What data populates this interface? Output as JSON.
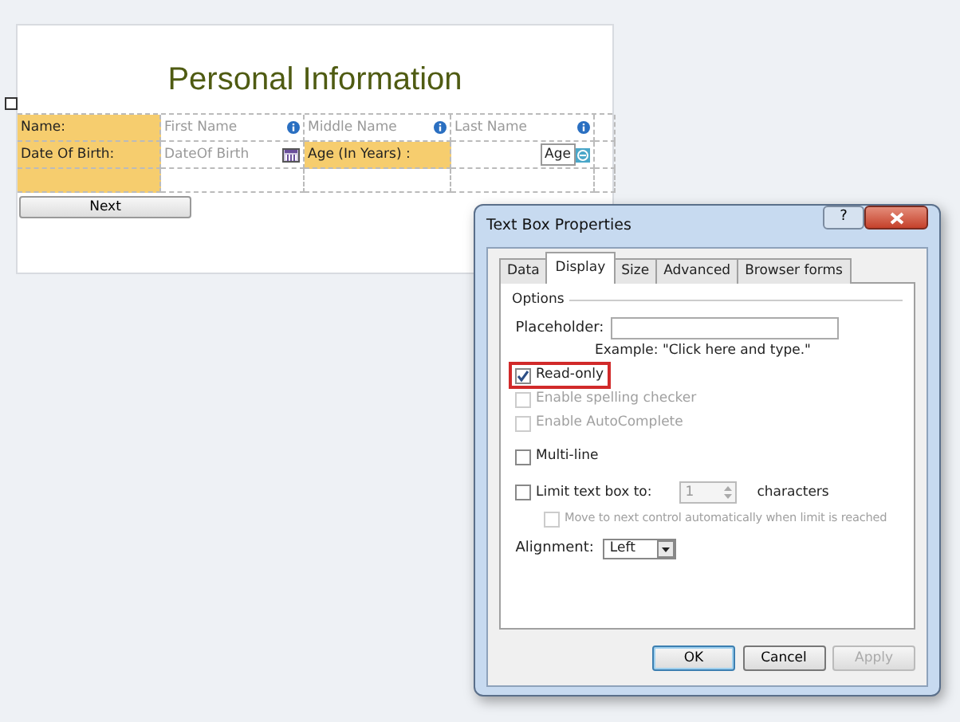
{
  "form": {
    "title": "Personal Information",
    "name_label": "Name:",
    "name_fields": [
      {
        "placeholder": "First Name"
      },
      {
        "placeholder": "Middle Name"
      },
      {
        "placeholder": "Last Name"
      }
    ],
    "dob_label": "Date Of Birth:",
    "dob_field": {
      "placeholder": "DateOf Birth"
    },
    "age_label": "Age (In Years) :",
    "age_field": {
      "value": "Age"
    },
    "next_button": "Next"
  },
  "dialog": {
    "title": "Text Box Properties",
    "help": "?",
    "tabs": [
      {
        "label": "Data",
        "selected": false
      },
      {
        "label": "Display",
        "selected": true
      },
      {
        "label": "Size",
        "selected": false
      },
      {
        "label": "Advanced",
        "selected": false
      },
      {
        "label": "Browser forms",
        "selected": false
      }
    ],
    "group": "Options",
    "placeholder_label": "Placeholder:",
    "placeholder_example": "Example: \"Click here and type.\"",
    "options": [
      {
        "kind": "check",
        "label": "Read-only",
        "checked": true,
        "disabled": false,
        "highlighted": true
      },
      {
        "kind": "check",
        "label": "Enable spelling checker",
        "checked": false,
        "disabled": true,
        "highlighted": false
      },
      {
        "kind": "check",
        "label": "Enable AutoComplete",
        "checked": false,
        "disabled": true,
        "highlighted": false
      },
      {
        "kind": "check",
        "label": "Multi-line",
        "checked": false,
        "disabled": false,
        "highlighted": false
      },
      {
        "kind": "limit",
        "label": "Limit text box to:",
        "checked": false,
        "disabled": false,
        "highlighted": false,
        "value": "1",
        "suffix": "characters"
      },
      {
        "kind": "subcheck",
        "label": "Move to next control automatically when limit is reached",
        "checked": false,
        "disabled": true,
        "highlighted": false
      }
    ],
    "alignment_label": "Alignment:",
    "alignment_value": "Left",
    "buttons": [
      {
        "label": "OK",
        "default": true,
        "disabled": false
      },
      {
        "label": "Cancel",
        "default": false,
        "disabled": false
      },
      {
        "label": "Apply",
        "default": false,
        "disabled": true
      }
    ]
  }
}
